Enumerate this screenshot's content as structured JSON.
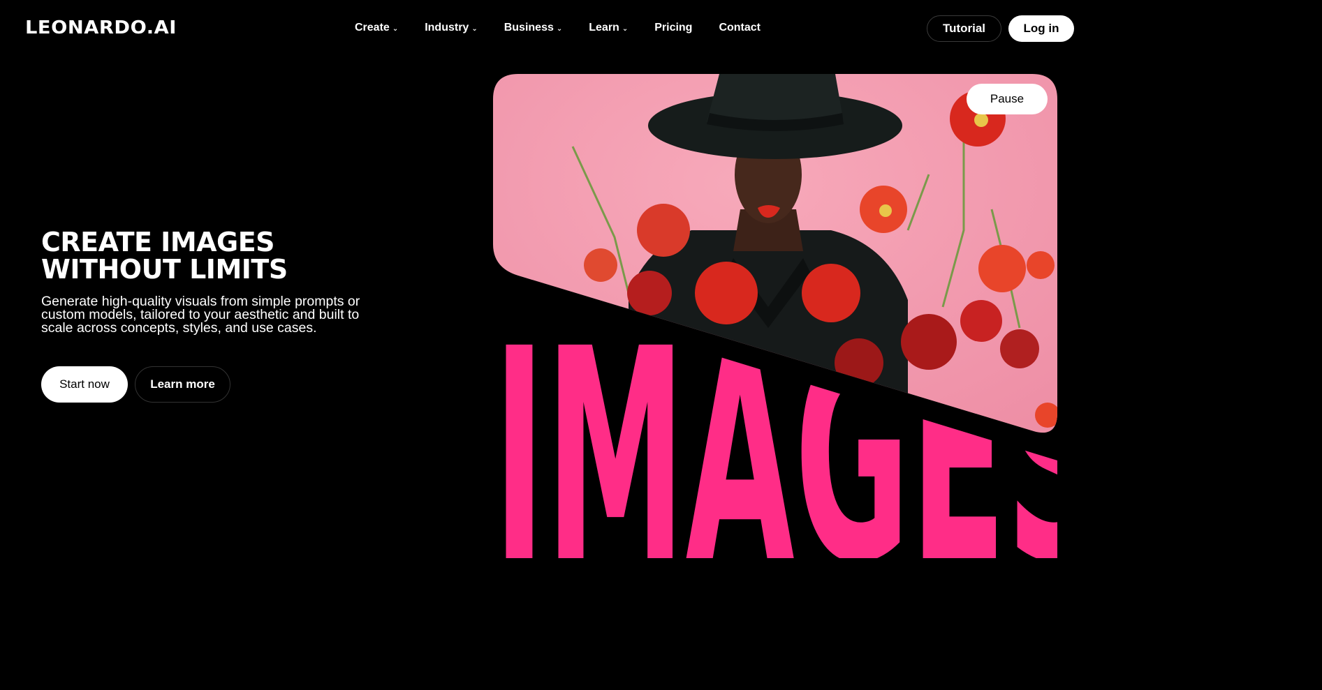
{
  "brand": {
    "logo_text": "LEONARDO.AI"
  },
  "nav": {
    "items": [
      {
        "label": "Create",
        "has_dropdown": true
      },
      {
        "label": "Industry",
        "has_dropdown": true
      },
      {
        "label": "Business",
        "has_dropdown": true
      },
      {
        "label": "Learn",
        "has_dropdown": true
      },
      {
        "label": "Pricing",
        "has_dropdown": false
      },
      {
        "label": "Contact",
        "has_dropdown": false
      }
    ],
    "chevron": "⌄"
  },
  "header": {
    "tutorial_label": "Tutorial",
    "login_label": "Log in"
  },
  "hero": {
    "title_line1": "CREATE IMAGES",
    "title_line2": "WITHOUT LIMITS",
    "subtitle": "Generate high-quality visuals from simple prompts or custom models, tailored to your aesthetic and built to scale across concepts, styles, and use cases.",
    "start_label": "Start now",
    "learn_label": "Learn more",
    "media_word": "IMAGES",
    "pause_label": "Pause"
  },
  "colors": {
    "background": "#000000",
    "accent_pink": "#ff2d87",
    "photo_background": "#f29aaf",
    "flower_red": "#d8281e"
  }
}
